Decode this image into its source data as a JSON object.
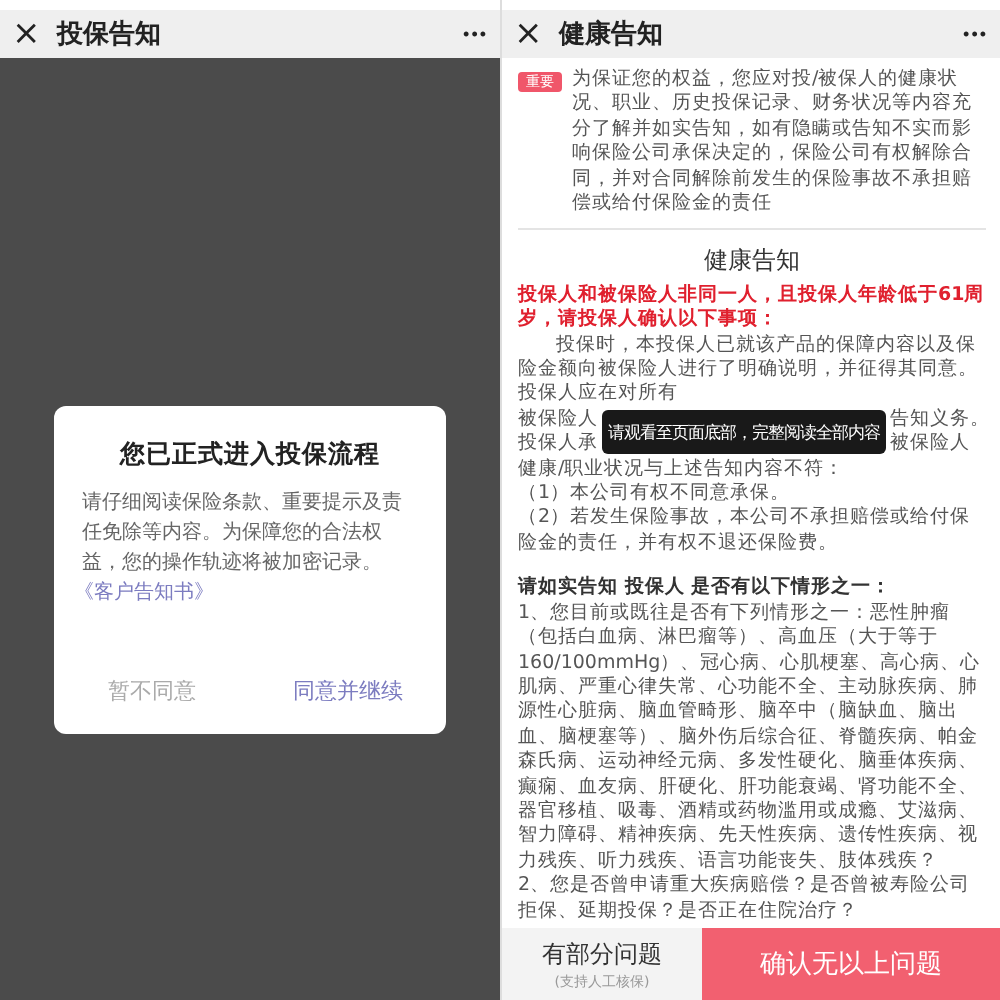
{
  "left_screen": {
    "header": {
      "close": "×",
      "title": "投保告知",
      "more": "•••"
    },
    "dialog": {
      "title": "您已正式进入投保流程",
      "body": "请仔细阅读保险条款、重要提示及责任免除等内容。为保障您的合法权益，您的操作轨迹将被加密记录。",
      "link": "《客户告知书》",
      "buttons": [
        {
          "label": "暂不同意",
          "primary": false
        },
        {
          "label": "同意并继续",
          "primary": true
        }
      ]
    }
  },
  "right_screen": {
    "header": {
      "close": "×",
      "title": "健康告知",
      "more": "•••"
    },
    "notice": {
      "tag": "重要",
      "text": "为保证您的权益，您应对投/被保人的健康状况、职业、历史投保记录、财务状况等内容充分了解并如实告知，如有隐瞒或告知不实而影响保险公司承保决定的，保险公司有权解除合同，并对合同解除前发生的保险事故不承担赔偿或给付保险金的责任"
    },
    "title": "健康告知",
    "warning": "投保人和被保险人非同一人，且投保人年龄低于61周岁，请投保人确认以下事项：",
    "paragraph": {
      "before": "投保时，本投保人已就该产品的保障内容以及保险金额向被保险人进行了明确说明，并征得其同意。投保人应在对所有",
      "covered_rows": [
        {
          "left": "被保险人",
          "right": "告知义务。"
        },
        {
          "left": "投保人承",
          "right": "被保险人"
        }
      ],
      "after": "健康/职业状况与上述告知内容不符："
    },
    "consequences": [
      "（1）本公司有权不同意承保。",
      "（2）若发生保险事故，本公司不承担赔偿或给付保险金的责任，并有权不退还保险费。"
    ],
    "question_heading": "请如实告知 投保人 是否有以下情形之一：",
    "questions": [
      "1、您目前或既往是否有下列情形之一：恶性肿瘤（包括白血病、淋巴瘤等）、高血压（大于等于 160/100mmHg）、冠心病、心肌梗塞、高心病、心肌病、严重心律失常、心功能不全、主动脉疾病、肺源性心脏病、脑血管畸形、脑卒中（脑缺血、脑出血、脑梗塞等）、脑外伤后综合征、脊髓疾病、帕金森氏病、运动神经元病、多发性硬化、脑垂体疾病、癫痫、血友病、肝硬化、肝功能衰竭、肾功能不全、器官移植、吸毒、酒精或药物滥用或成瘾、艾滋病、智力障碍、精神疾病、先天性疾病、遗传性疾病、视力残疾、听力残疾、语言功能丧失、肢体残疾？",
      "2、您是否曾申请重大疾病赔偿？是否曾被寿险公司拒保、延期投保？是否正在住院治疗？"
    ],
    "toast": "请观看至页面底部，完整阅读全部内容",
    "footer": {
      "secondary": {
        "label": "有部分问题",
        "sublabel": "(支持人工核保)"
      },
      "primary": {
        "label": "确认无以上问题"
      }
    }
  }
}
